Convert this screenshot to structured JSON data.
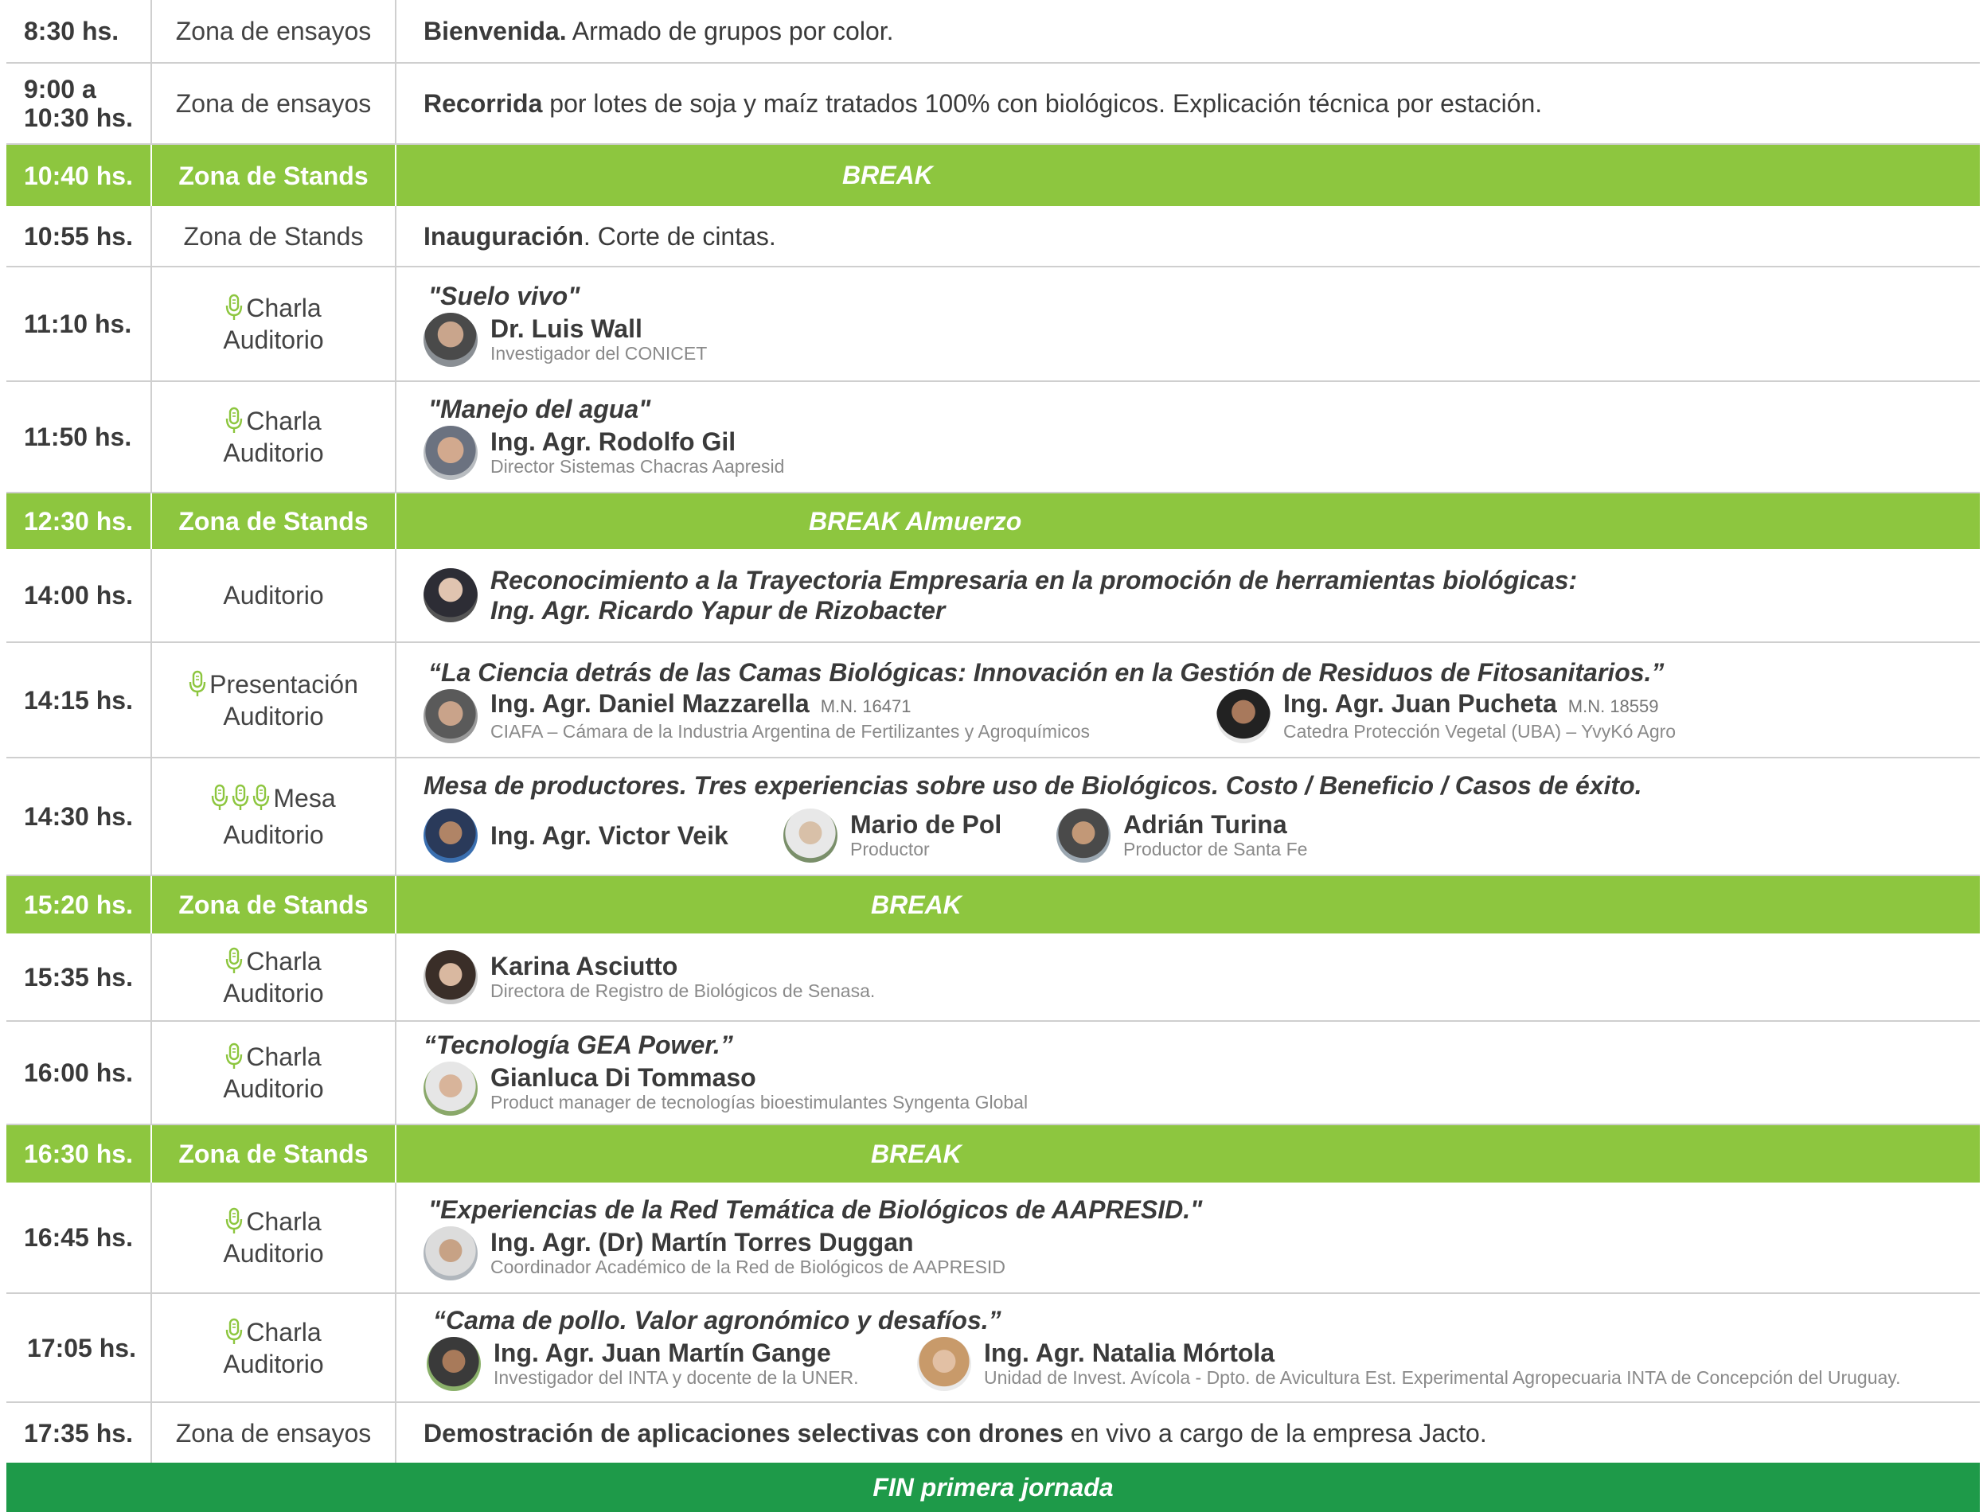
{
  "colors": {
    "break_green": "#8dc63f",
    "fin_green": "#1e9a49",
    "mic_green": "#8dc63f",
    "text_dark": "#3a3a3a"
  },
  "rows": [
    {
      "time": "8:30 hs.",
      "location": "Zona de ensayos",
      "desc_bold": "Bienvenida.",
      "desc_rest": " Armado de grupos por color."
    },
    {
      "time_l1": "9:00 a",
      "time_l2": "10:30 hs.",
      "location": "Zona de ensayos",
      "desc_bold": "Recorrida",
      "desc_rest": " por lotes de soja y maíz tratados 100% con biológicos. Explicación técnica por estación."
    },
    {
      "time": "10:40 hs.",
      "location": "Zona de Stands",
      "label": "BREAK"
    },
    {
      "time": "10:55 hs.",
      "location": "Zona de Stands",
      "desc_bold": "Inauguración",
      "desc_rest": ". Corte de cintas."
    },
    {
      "time": "11:10 hs.",
      "loc_type": "Charla",
      "loc_place": "Auditorio",
      "title": "\"Suelo vivo\"",
      "speakers": [
        {
          "name": "Dr. Luis Wall",
          "role": "Investigador del CONICET"
        }
      ]
    },
    {
      "time": "11:50 hs.",
      "loc_type": "Charla",
      "loc_place": "Auditorio",
      "title": "\"Manejo del agua\"",
      "speakers": [
        {
          "name": "Ing. Agr. Rodolfo Gil",
          "role": "Director Sistemas Chacras Aapresid"
        }
      ]
    },
    {
      "time": "12:30 hs.",
      "location": "Zona de Stands",
      "label": "BREAK Almuerzo"
    },
    {
      "time": "14:00 hs.",
      "location": "Auditorio",
      "line1": "Reconocimiento a la Trayectoria Empresaria en la promoción de herramientas biológicas:",
      "line2": "Ing. Agr. Ricardo Yapur de Rizobacter"
    },
    {
      "time": "14:15 hs.",
      "loc_type": "Presentación",
      "loc_place": "Auditorio",
      "title": "“La Ciencia detrás de las Camas Biológicas: Innovación en la Gestión de Residuos de Fitosanitarios.”",
      "speakers": [
        {
          "name": "Ing. Agr. Daniel Mazzarella",
          "mn": "M.N. 16471",
          "role": "CIAFA – Cámara de la Industria Argentina de Fertilizantes y Agroquímicos"
        },
        {
          "name": "Ing. Agr. Juan Pucheta",
          "mn": "M.N. 18559",
          "role": "Catedra Protección Vegetal (UBA) – YvyKó Agro"
        }
      ]
    },
    {
      "time": "14:30 hs.",
      "loc_type": "Mesa",
      "loc_place": "Auditorio",
      "title": "Mesa de productores. Tres experiencias sobre uso de Biológicos. Costo / Beneficio / Casos de éxito.",
      "speakers": [
        {
          "name": "Ing. Agr. Victor Veik",
          "role": ""
        },
        {
          "name": "Mario de Pol",
          "role": "Productor"
        },
        {
          "name": "Adrián Turina",
          "role": "Productor de Santa Fe"
        }
      ]
    },
    {
      "time": "15:20 hs.",
      "location": "Zona de Stands",
      "label": "BREAK"
    },
    {
      "time": "15:35 hs.",
      "loc_type": "Charla",
      "loc_place": "Auditorio",
      "speakers": [
        {
          "name": "Karina Asciutto",
          "role": "Directora de Registro de Biológicos de Senasa."
        }
      ]
    },
    {
      "time": "16:00 hs.",
      "loc_type": "Charla",
      "loc_place": "Auditorio",
      "title": "“Tecnología GEA Power.”",
      "speakers": [
        {
          "name": "Gianluca Di Tommaso",
          "role": "Product manager de tecnologías bioestimulantes Syngenta Global"
        }
      ]
    },
    {
      "time": "16:30 hs.",
      "location": "Zona de Stands",
      "label": "BREAK"
    },
    {
      "time": "16:45 hs.",
      "loc_type": "Charla",
      "loc_place": "Auditorio",
      "title": "\"Experiencias de la Red Temática de Biológicos de AAPRESID.\"",
      "speakers": [
        {
          "name": "Ing. Agr. (Dr) Martín Torres Duggan",
          "role": "Coordinador Académico de la Red de Biológicos de AAPRESID"
        }
      ]
    },
    {
      "time": "17:05 hs.",
      "loc_type": "Charla",
      "loc_place": "Auditorio",
      "title": "“Cama de pollo. Valor agronómico y desafíos.”",
      "speakers": [
        {
          "name": "Ing. Agr. Juan Martín Gange",
          "role": "Investigador del INTA y docente de la UNER."
        },
        {
          "name": "Ing. Agr. Natalia Mórtola",
          "role": "Unidad de Invest. Avícola - Dpto. de Avicultura Est. Experimental Agropecuaria INTA de Concepción del Uruguay."
        }
      ]
    },
    {
      "time": "17:35 hs.",
      "location": "Zona de ensayos",
      "desc_bold": "Demostración de aplicaciones selectivas con drones",
      "desc_rest": " en vivo a cargo de la empresa Jacto."
    },
    {
      "label": "FIN primera jornada"
    }
  ]
}
